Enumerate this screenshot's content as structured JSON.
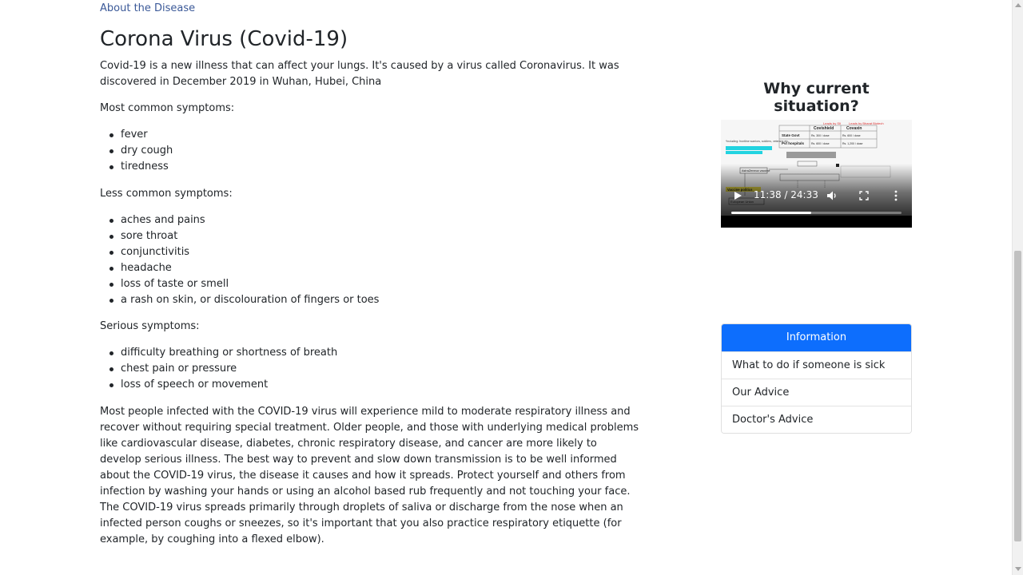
{
  "breadcrumb": "About the Disease",
  "title": "Corona Virus (Covid-19)",
  "intro": "Covid-19 is a new illness that can affect your lungs. It's caused by a virus called Coronavirus. It was discovered in December 2019 in Wuhan, Hubei, China",
  "common": {
    "heading": "Most common symptoms:",
    "items": [
      "fever",
      "dry cough",
      "tiredness"
    ]
  },
  "less_common": {
    "heading": "Less common symptoms:",
    "items": [
      "aches and pains",
      "sore throat",
      "conjunctivitis",
      "headache",
      "loss of taste or smell",
      "a rash on skin, or discolouration of fingers or toes"
    ]
  },
  "serious": {
    "heading": "Serious symptoms:",
    "items": [
      "difficulty breathing or shortness of breath",
      "chest pain or pressure",
      "loss of speech or movement"
    ]
  },
  "body_text": "Most people infected with the COVID-19 virus will experience mild to moderate respiratory illness and recover without requiring special treatment. Older people, and those with underlying medical problems like cardiovascular disease, diabetes, chronic respiratory disease, and cancer are more likely to develop serious illness. The best way to prevent and slow down transmission is to be well informed about the COVID-19 virus, the disease it causes and how it spreads. Protect yourself and others from infection by washing your hands or using an alcohol based rub frequently and not touching your face. The COVID-19 virus spreads primarily through droplets of saliva or discharge from the nose when an infected person coughs or sneezes, so it's important that you also practice respiratory etiquette (for example, by coughing into a flexed elbow).",
  "sidebar": {
    "video_title": "Why current situation?",
    "video": {
      "time": "11:38 / 24:33",
      "progress": 0.47,
      "slide": {
        "header_left": "Leads by SII",
        "header_right": "Leads by Bharat Biotech",
        "col1": "Covishield",
        "col2": "Covaxin",
        "row1_label": "State Govt",
        "row1_a": "Rs. 300 / dose",
        "row1_b": "Rs. 600 / dose",
        "row2_label": "Pvt hospitals",
        "row2_a": "Rs. 600 / dose",
        "row2_b": "Rs. 1,200 / dose",
        "note": "*including: frontline warriors, soldiers, veterans etc",
        "left_box": "AstraZeneca vaccine",
        "bottom_left": "European Union",
        "yellow_tag": "Vaccine politics"
      }
    },
    "list_header": "Information",
    "list_items": [
      "What to do if someone is sick",
      "Our Advice",
      "Doctor's Advice"
    ]
  },
  "colors": {
    "accent": "#0d6efd",
    "link": "#3b5998",
    "text": "#212529"
  }
}
